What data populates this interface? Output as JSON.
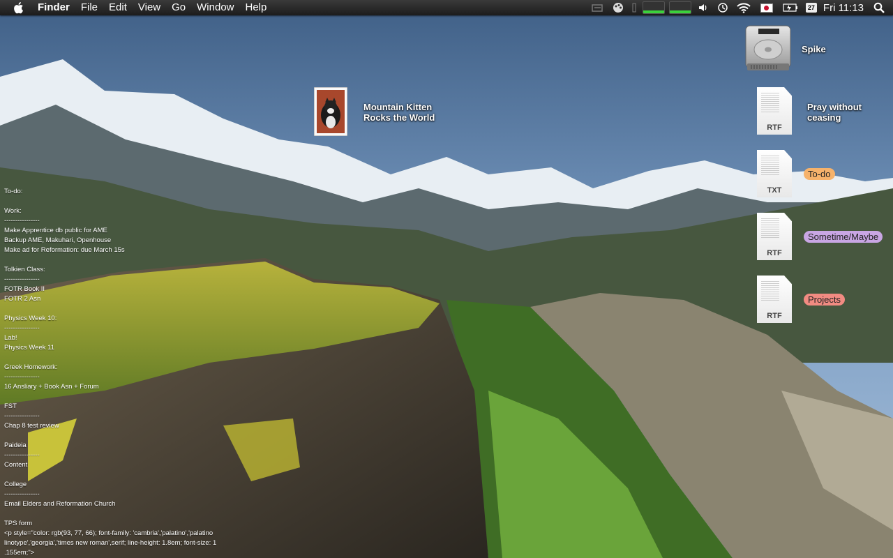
{
  "menubar": {
    "app_name": "Finder",
    "menus": [
      "File",
      "Edit",
      "View",
      "Go",
      "Window",
      "Help"
    ],
    "calendar_day": "27",
    "clock": "Fri 11:13"
  },
  "desktop_icons": {
    "photo": {
      "label_line1": "Mountain Kitten",
      "label_line2": "Rocks the World"
    },
    "drive": {
      "label": "Spike"
    },
    "doc_pray": {
      "label_line1": "Pray without",
      "label_line2": "ceasing",
      "type": "RTF"
    },
    "doc_todo": {
      "label": "To-do",
      "type": "TXT",
      "tag_color": "#f6b26b"
    },
    "doc_someday": {
      "label": "Sometime/Maybe",
      "type": "RTF",
      "tag_color": "#c9a6e4"
    },
    "doc_projects": {
      "label": "Projects",
      "type": "RTF",
      "tag_color": "#f28b82"
    }
  },
  "notes": [
    "To-do:",
    "",
    "Work:",
    "----------------",
    "Make Apprentice db public for AME",
    "Backup AME, Makuhari, Openhouse",
    "Make ad for Reformation: due March 15s",
    "",
    "Tolkien Class:",
    "----------------",
    "FOTR Book II",
    "FOTR 2 Asn",
    "",
    "Physics Week 10:",
    "----------------",
    "Lab!",
    "Physics Week 11",
    "",
    "Greek Homework:",
    "----------------",
    "16 Ansliary + Book Asn + Forum",
    "",
    "FST",
    "----------------",
    "Chap 8 test review",
    "",
    "Paideia",
    "----------------",
    "Content",
    "",
    "College",
    "----------------",
    "Email Elders and Reformation Church",
    "",
    "TPS form",
    "<p style=\"color: rgb(93, 77, 66); font-family: 'cambria','palatino','palatino",
    "linotype','georgia','times new roman',serif; line-height: 1.8em; font-size: 1",
    ".155em;\">"
  ]
}
